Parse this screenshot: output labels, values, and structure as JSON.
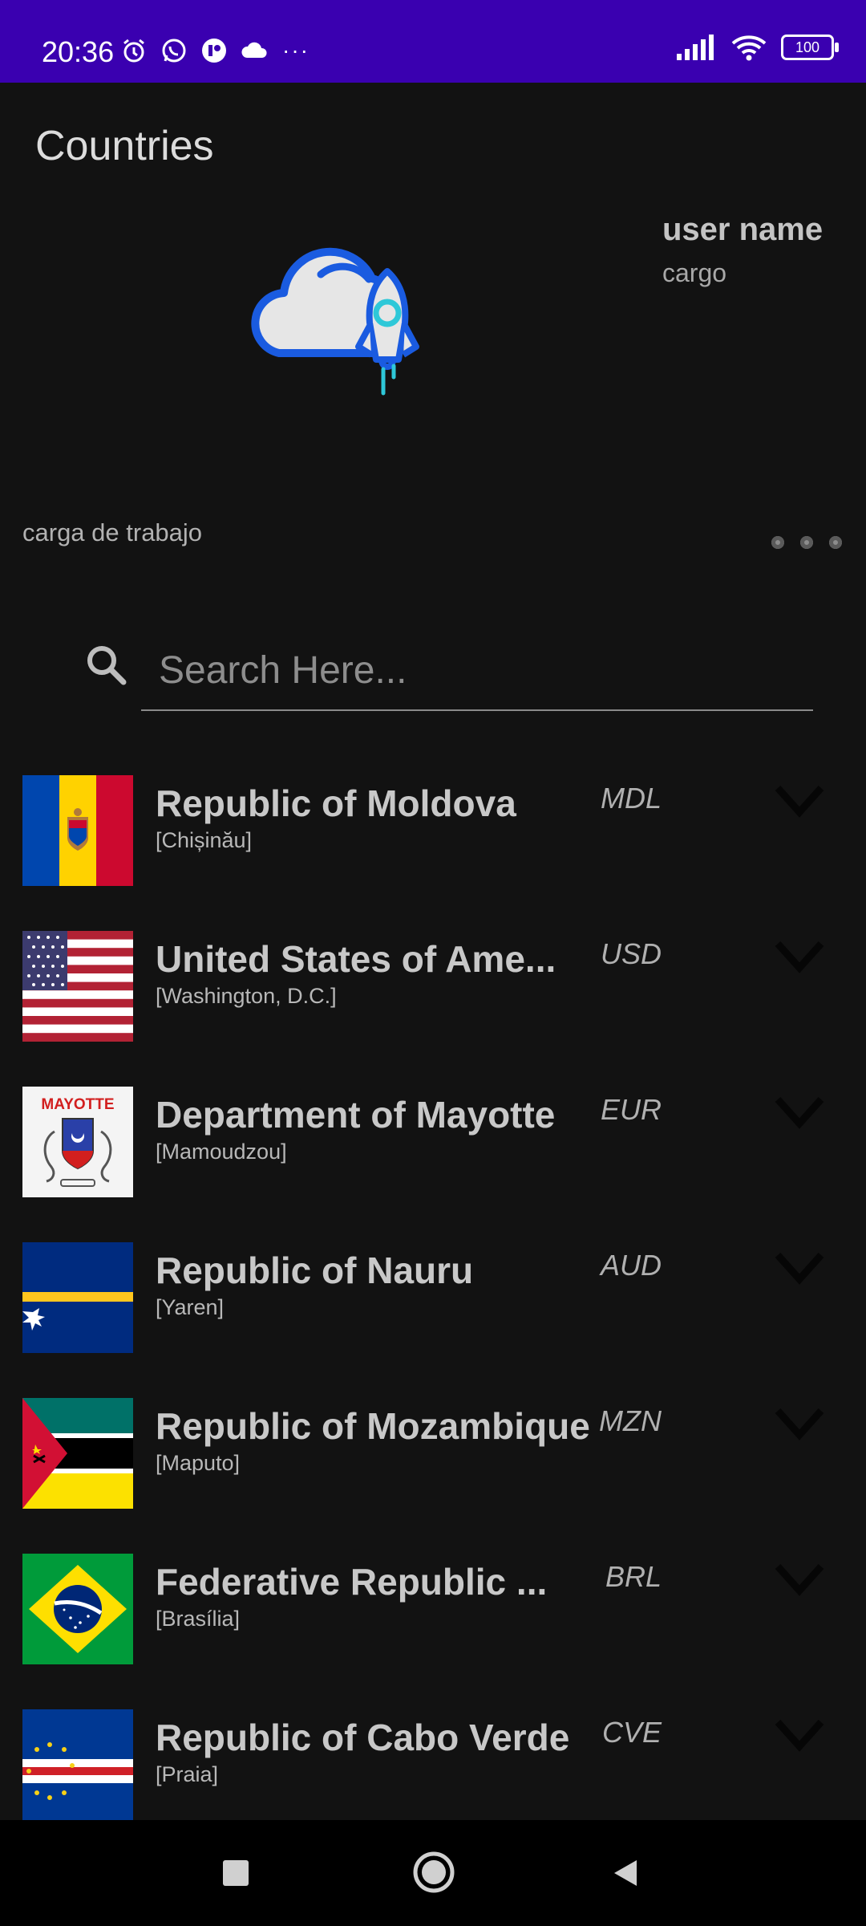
{
  "status_bar": {
    "time": "20:36",
    "battery": "100",
    "more": "···",
    "left_icons": [
      "alarm-icon",
      "whatsapp-icon",
      "app-icon",
      "cloud-icon"
    ],
    "right_icons": [
      "signal-icon",
      "wifi-icon",
      "battery-icon"
    ]
  },
  "app_bar": {
    "title": "Countries"
  },
  "header": {
    "user_name": "user name",
    "user_role": "cargo",
    "workload": "carga de trabajo",
    "logo_icon": "cloud-rocket-icon"
  },
  "search": {
    "placeholder": "Search Here..."
  },
  "countries": [
    {
      "name": "Republic of Moldova",
      "capital": "[Chișinău]",
      "currency": "MDL",
      "flag": "moldova"
    },
    {
      "name": "United States of Ame...",
      "capital": "[Washington,  D.C.]",
      "currency": "USD",
      "flag": "usa"
    },
    {
      "name": "Department of Mayotte",
      "capital": "[Mamoudzou]",
      "currency": "EUR",
      "flag": "mayotte",
      "flag_text": "MAYOTTE"
    },
    {
      "name": "Republic of Nauru",
      "capital": "[Yaren]",
      "currency": "AUD",
      "flag": "nauru"
    },
    {
      "name": "Republic of Mozambique",
      "capital": "[Maputo]",
      "currency": "MZN",
      "flag": "mozambique"
    },
    {
      "name": "Federative Republic ...",
      "capital": "[Brasília]",
      "currency": "BRL",
      "flag": "brazil"
    },
    {
      "name": "Republic of Cabo Verde",
      "capital": "[Praia]",
      "currency": "CVE",
      "flag": "cabo-verde"
    }
  ],
  "nav": {
    "recents": "square-icon",
    "home": "circle-icon",
    "back": "triangle-back-icon"
  },
  "colors": {
    "status_bar": "#3a00b0",
    "background": "#121212",
    "logo_blue": "#1a5be0",
    "logo_cyan": "#2ec8d8"
  }
}
